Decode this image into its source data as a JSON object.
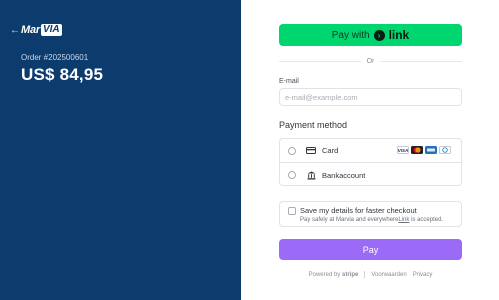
{
  "merchant": {
    "back_arrow": "←",
    "logo_text": "Mar",
    "logo_box_text": "VIA",
    "order_label": "Order #202500601",
    "amount": "US$ 84,95"
  },
  "checkout": {
    "paylink": {
      "label": "Pay with",
      "link_word": "link",
      "icon": "link-arrow-icon"
    },
    "or_text": "Or",
    "email": {
      "label": "E-mail",
      "placeholder": "e-mail@example.com",
      "value": ""
    },
    "payment_method": {
      "title": "Payment method",
      "options": [
        {
          "label": "Card",
          "icon": "card-icon",
          "brands": [
            "VISA",
            "MC",
            "AMEX",
            "DC"
          ]
        },
        {
          "label": "Bankaccount",
          "icon": "bank-icon"
        }
      ]
    },
    "save_details": {
      "title": "Save my details for faster checkout",
      "subtitle_prefix": "Pay safely at Marvia and everywhere",
      "subtitle_link": "Link",
      "subtitle_suffix": " is accepted."
    },
    "pay_label": "Pay",
    "footer": {
      "powered_by": "Powered by",
      "stripe": "stripe",
      "terms": "Voorwaarden",
      "privacy": "Privacy"
    }
  },
  "colors": {
    "left_bg": "#0c3b6e",
    "link_green": "#00d66f",
    "pay_purple": "#9b6af7"
  }
}
